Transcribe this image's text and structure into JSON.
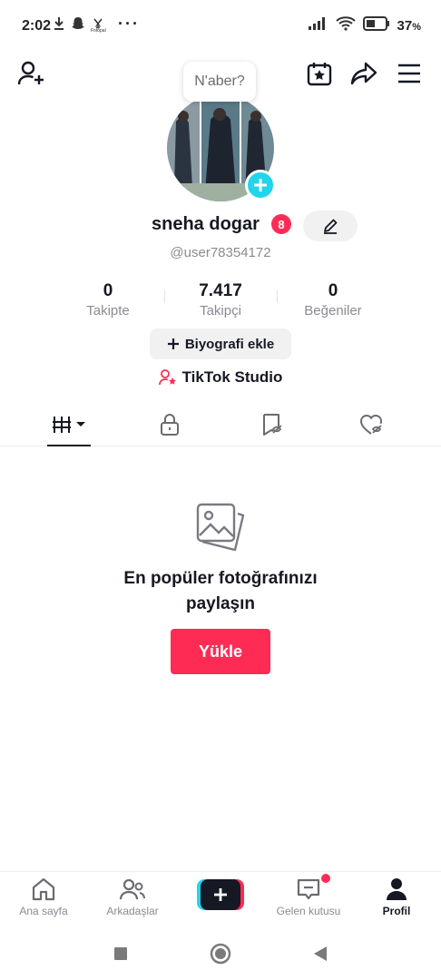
{
  "status_bar": {
    "time": "2:02",
    "battery_percent": "37",
    "battery_suffix": "%",
    "notification_icons": [
      "download-icon",
      "snapchat-icon",
      "fotopal-icon",
      "more-dots-icon"
    ],
    "fotopal_label": "Fotopal",
    "right_icons": [
      "signal-icon",
      "wifi-icon",
      "battery-icon"
    ]
  },
  "header": {
    "add_friend_icon": "add-user-icon",
    "calendar_icon": "calendar-star-icon",
    "share_icon": "share-icon",
    "menu_icon": "hamburger-menu-icon",
    "bubble_text": "N'aber?"
  },
  "profile": {
    "display_name": "sneha  dogar",
    "badge_count": "8",
    "username": "@user78354172",
    "stats": [
      {
        "value": "0",
        "label": "Takipte"
      },
      {
        "value": "7.417",
        "label": "Takipçi"
      },
      {
        "value": "0",
        "label": "Beğeniler"
      }
    ],
    "bio_button": "Biyografi ekle",
    "studio_label": "TikTok Studio"
  },
  "tabs": [
    {
      "icon": "grid-videos-icon",
      "active": true
    },
    {
      "icon": "lock-icon",
      "active": false
    },
    {
      "icon": "bookmark-icon",
      "active": false
    },
    {
      "icon": "liked-heart-icon",
      "active": false
    }
  ],
  "empty_state": {
    "icon": "photos-icon",
    "title_line1": "En popüler fotoğrafınızı",
    "title_line2": "paylaşın",
    "button": "Yükle"
  },
  "bottom_nav": {
    "items": [
      {
        "label": "Ana sayfa",
        "icon": "home-icon",
        "active": false
      },
      {
        "label": "Arkadaşlar",
        "icon": "friends-icon",
        "active": false
      },
      {
        "label": "",
        "icon": "create-plus-icon",
        "active": false
      },
      {
        "label": "Gelen kutusu",
        "icon": "inbox-icon",
        "active": false
      },
      {
        "label": "Profil",
        "icon": "profile-icon",
        "active": true
      }
    ]
  },
  "android_nav": [
    "recents-square-icon",
    "home-circle-icon",
    "back-triangle-icon"
  ],
  "colors": {
    "accent": "#fe2c55",
    "cyan": "#20d5ec",
    "text": "#161823",
    "muted": "#8a8b91"
  }
}
